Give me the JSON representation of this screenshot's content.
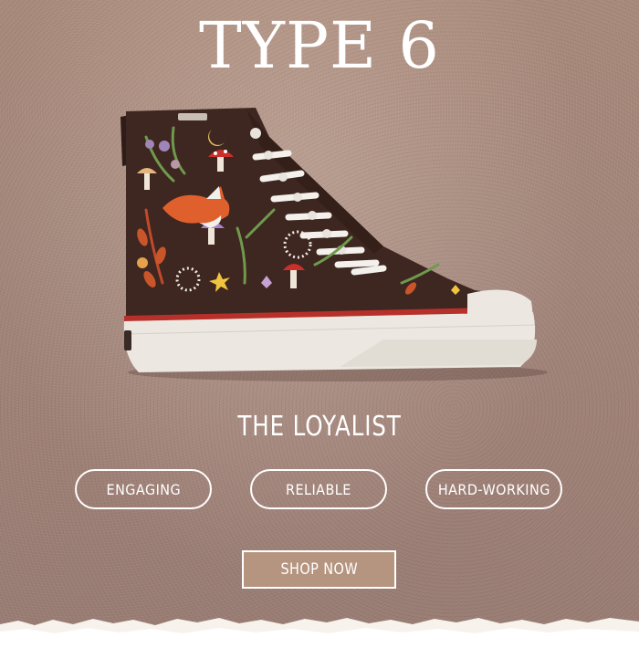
{
  "header": {
    "title": "TYPE 6"
  },
  "product": {
    "name": "THE LOYALIST",
    "traits": [
      "ENGAGING",
      "RELIABLE",
      "HARD-WORKING"
    ]
  },
  "cta": {
    "label": "SHOP NOW"
  },
  "colors": {
    "background": "#a08279",
    "shoe_canvas": "#3e2621",
    "sole": "#ece8e1",
    "red_stripe": "#b8302a",
    "button_fill": "#b5957f",
    "text": "#ffffff"
  }
}
